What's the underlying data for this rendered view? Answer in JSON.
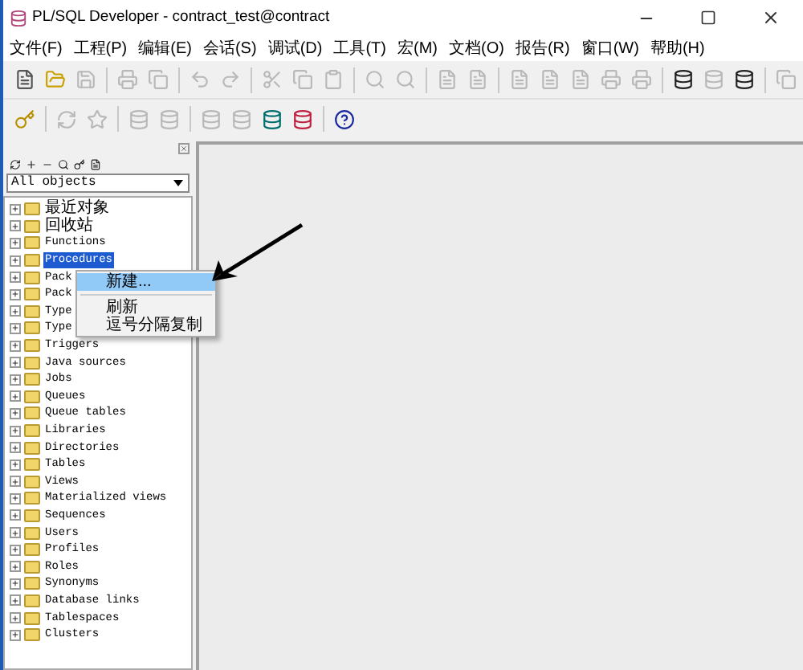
{
  "window": {
    "title": "PL/SQL Developer - contract_test@contract"
  },
  "menu": [
    "文件(F)",
    "工程(P)",
    "编辑(E)",
    "会话(S)",
    "调试(D)",
    "工具(T)",
    "宏(M)",
    "文档(O)",
    "报告(R)",
    "窗口(W)",
    "帮助(H)"
  ],
  "object_filter": {
    "value": "All objects"
  },
  "tree": [
    {
      "label": "最近对象",
      "selected": false,
      "cjk": true
    },
    {
      "label": "回收站",
      "selected": false,
      "cjk": true
    },
    {
      "label": "Functions",
      "selected": false
    },
    {
      "label": "Procedures",
      "selected": true
    },
    {
      "label": "Pack",
      "selected": false
    },
    {
      "label": "Pack",
      "selected": false
    },
    {
      "label": "Type",
      "selected": false
    },
    {
      "label": "Type",
      "selected": false
    },
    {
      "label": "Triggers",
      "selected": false
    },
    {
      "label": "Java sources",
      "selected": false
    },
    {
      "label": "Jobs",
      "selected": false
    },
    {
      "label": "Queues",
      "selected": false
    },
    {
      "label": "Queue tables",
      "selected": false
    },
    {
      "label": "Libraries",
      "selected": false
    },
    {
      "label": "Directories",
      "selected": false
    },
    {
      "label": "Tables",
      "selected": false
    },
    {
      "label": "Views",
      "selected": false
    },
    {
      "label": "Materialized views",
      "selected": false
    },
    {
      "label": "Sequences",
      "selected": false
    },
    {
      "label": "Users",
      "selected": false
    },
    {
      "label": "Profiles",
      "selected": false
    },
    {
      "label": "Roles",
      "selected": false
    },
    {
      "label": "Synonyms",
      "selected": false
    },
    {
      "label": "Database links",
      "selected": false
    },
    {
      "label": "Tablespaces",
      "selected": false
    },
    {
      "label": "Clusters",
      "selected": false
    }
  ],
  "context_menu": [
    {
      "label": "新建...",
      "selected": true,
      "separator_after": true
    },
    {
      "label": "刷新",
      "selected": false,
      "separator_after": false
    },
    {
      "label": "逗号分隔复制",
      "selected": false
    }
  ]
}
